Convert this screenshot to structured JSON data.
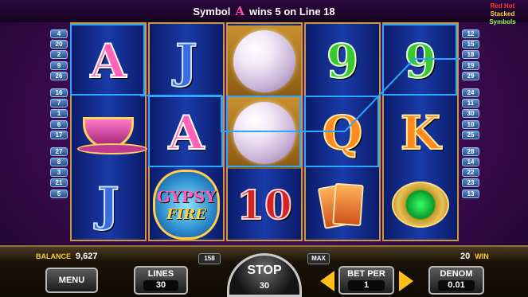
{
  "header": {
    "msg_prefix": "Symbol",
    "symbol": "A",
    "msg_suffix": "wins 5 on Line 18",
    "brand_lines": [
      "Red Hot",
      "Stacked",
      "Symbols"
    ]
  },
  "paylines": {
    "left": [
      [
        "4",
        "20",
        "2",
        "9",
        "26"
      ],
      [
        "16",
        "7",
        "1",
        "6",
        "17"
      ],
      [
        "27",
        "8",
        "3",
        "21",
        "5"
      ]
    ],
    "right": [
      [
        "12",
        "15",
        "18",
        "19",
        "29"
      ],
      [
        "24",
        "11",
        "30",
        "10",
        "25"
      ],
      [
        "28",
        "14",
        "22",
        "23",
        "13"
      ]
    ]
  },
  "reels": [
    [
      "A",
      "teacup",
      "J"
    ],
    [
      "J",
      "A",
      "GYPSY FIRE"
    ],
    [
      "pearl",
      "pearl",
      "10"
    ],
    [
      "9",
      "Q",
      "cards"
    ],
    [
      "9",
      "K",
      "emerald ring"
    ]
  ],
  "symbols_text": {
    "r0c0": "A",
    "r0c2": "J",
    "r1c0": "J",
    "r1c1": "A",
    "gypsy1": "GYPSY",
    "gypsy2": "FIRE",
    "r2c2": "10",
    "r3c0": "9",
    "r3c1": "Q",
    "r4c0": "9",
    "r4c1": "K"
  },
  "colors": {
    "highlight": "#2aa7ff",
    "accent_gold": "#ffcc33",
    "reel_blue": "#1a3ba8"
  },
  "footer": {
    "balance_label": "BALANCE",
    "balance_value": "9,627",
    "win_value": "20",
    "win_label": "WIN",
    "chip_left": "158",
    "chip_right": "MAX",
    "menu_label": "MENU",
    "lines_label": "LINES",
    "lines_value": "30",
    "stop_label": "STOP",
    "stop_value": "30",
    "betper_label": "BET PER",
    "betper_value": "1",
    "denom_label": "DENOM",
    "denom_value": "0.01"
  }
}
